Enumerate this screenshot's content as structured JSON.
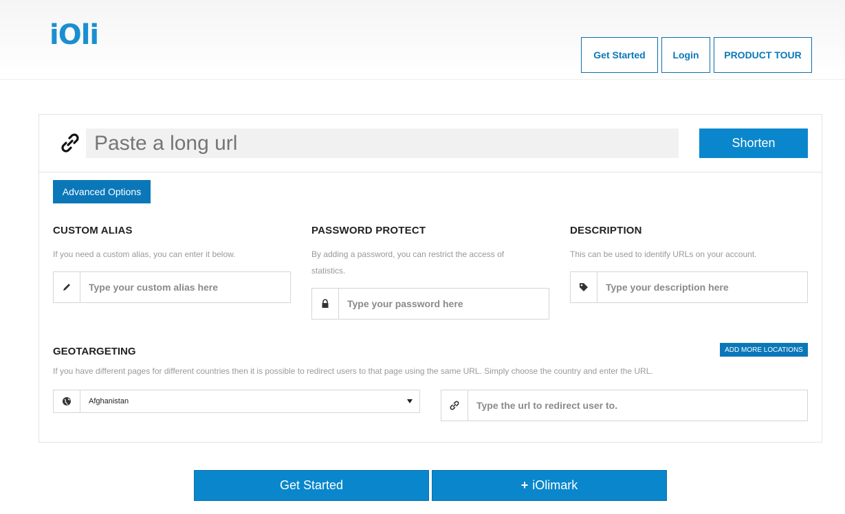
{
  "header": {
    "logo": "iOli",
    "nav": {
      "get_started": "Get Started",
      "login": "Login",
      "product_tour": "PRODUCT TOUR"
    }
  },
  "url_bar": {
    "placeholder": "Paste a long url",
    "shorten_label": "Shorten",
    "icon": "link-icon"
  },
  "advanced_options_label": "Advanced Options",
  "custom_alias": {
    "title": "CUSTOM ALIAS",
    "description": "If you need a custom alias, you can enter it below.",
    "placeholder": "Type your custom alias here",
    "icon": "pencil-icon"
  },
  "password_protect": {
    "title": "PASSWORD PROTECT",
    "description": "By adding a password, you can restrict the access of statistics.",
    "placeholder": "Type your password here",
    "icon": "lock-icon"
  },
  "description_field": {
    "title": "DESCRIPTION",
    "description": "This can be used to identify URLs on your account.",
    "placeholder": "Type your description here",
    "icon": "tag-icon"
  },
  "geotargeting": {
    "title": "GEOTARGETING",
    "add_more_label": "ADD MORE LOCATIONS",
    "description": "If you have different pages for different countries then it is possible to redirect users to that page using the same URL. Simply choose the country and enter the URL.",
    "country_selected": "Afghanistan",
    "url_placeholder": "Type the url to redirect user to.",
    "icons": [
      "globe-icon",
      "link-icon"
    ]
  },
  "bottom": {
    "get_started": "Get Started",
    "iolimark": "iOlimark"
  },
  "colors": {
    "primary": "#0a87cc",
    "dark_primary": "#0a77b8",
    "logo": "#1a8fd0"
  }
}
